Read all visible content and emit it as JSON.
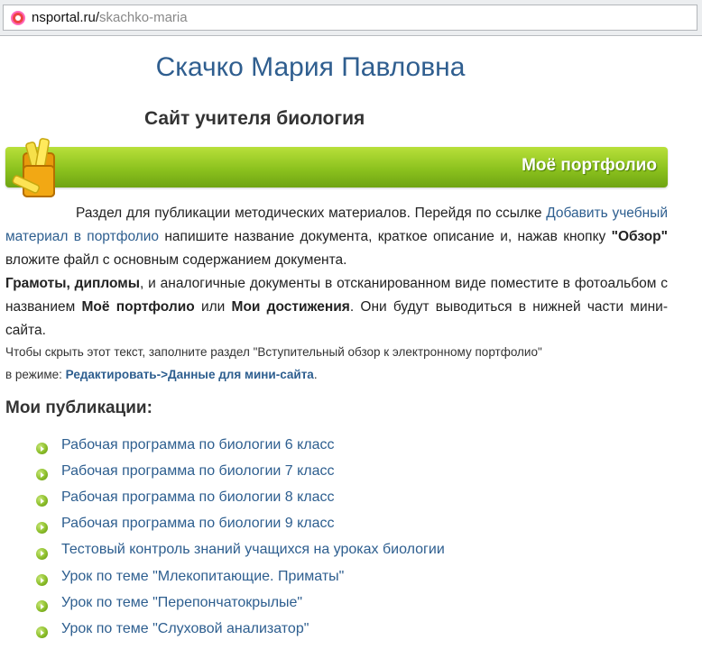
{
  "browser": {
    "url_host": "nsportal.ru/",
    "url_path": "skachko-maria"
  },
  "header": {
    "title": "Скачко Мария Павловна",
    "subtitle": "Сайт учителя биология"
  },
  "banner": {
    "label": "Моё портфолио",
    "icon": "folder-icon"
  },
  "description": {
    "p1_intro": "Раздел для публикации методических материалов. Перейдя по ссылке",
    "p1_link": "Добавить учебный материал в портфолио",
    "p1_after_link": " напишите название документа, краткое описание и, нажав кнопку ",
    "p1_button": "\"Обзор\"",
    "p1_end": " вложите файл с основным содержанием документа.",
    "p2_start": "Грамоты, дипломы",
    "p2_mid1": ", и аналогичные документы в отсканированном виде поместите в фотоальбом с названием ",
    "p2_album1": "Моё портфолио",
    "p2_or": " или ",
    "p2_album2": "Мои достижения",
    "p2_end": ". Они будут выводиться в нижней части мини-сайта."
  },
  "note": {
    "text1": "Чтобы скрыть этот текст, заполните раздел \"Вступительный обзор к электронному портфолио\"",
    "text2": "в режиме: ",
    "action": "Редактировать->Данные для мини-сайта",
    "text3": "."
  },
  "publications": {
    "heading": "Мои публикации:",
    "items": [
      "Рабочая программа по биологии 6 класс",
      "Рабочая программа по биологии 7 класс",
      "Рабочая программа по биологии 8 класс",
      "Рабочая программа по биологии 9 класс",
      "Тестовый контроль знаний учащихся на уроках биологии",
      "Урок по теме \"Млекопитающие. Приматы\"",
      "Урок по теме \"Перепончатокрылые\"",
      "Урок по теме \"Слуховой анализатор\""
    ]
  },
  "colors": {
    "accent_green": "#8cc21e",
    "link_blue": "#2d5e8f"
  }
}
